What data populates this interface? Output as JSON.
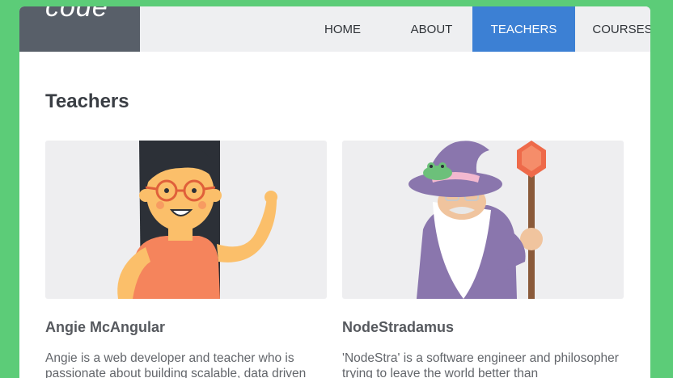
{
  "header": {
    "logo_text": "code",
    "nav": [
      {
        "label": "HOME",
        "active": false
      },
      {
        "label": "ABOUT",
        "active": false
      },
      {
        "label": "TEACHERS",
        "active": true
      },
      {
        "label": "COURSES",
        "active": false
      }
    ]
  },
  "main": {
    "title": "Teachers",
    "teachers": [
      {
        "name": "Angie McAngular",
        "bio": "Angie is a web developer and teacher who is passionate about building scalable, data driven"
      },
      {
        "name": "NodeStradamus",
        "bio": "'NodeStra' is a software engineer and philosopher trying to leave the world better than"
      }
    ]
  },
  "colors": {
    "page_bg": "#5ccc78",
    "header_bg": "#eeeff1",
    "logo_bg": "#585f69",
    "active_nav": "#3c80d4"
  }
}
